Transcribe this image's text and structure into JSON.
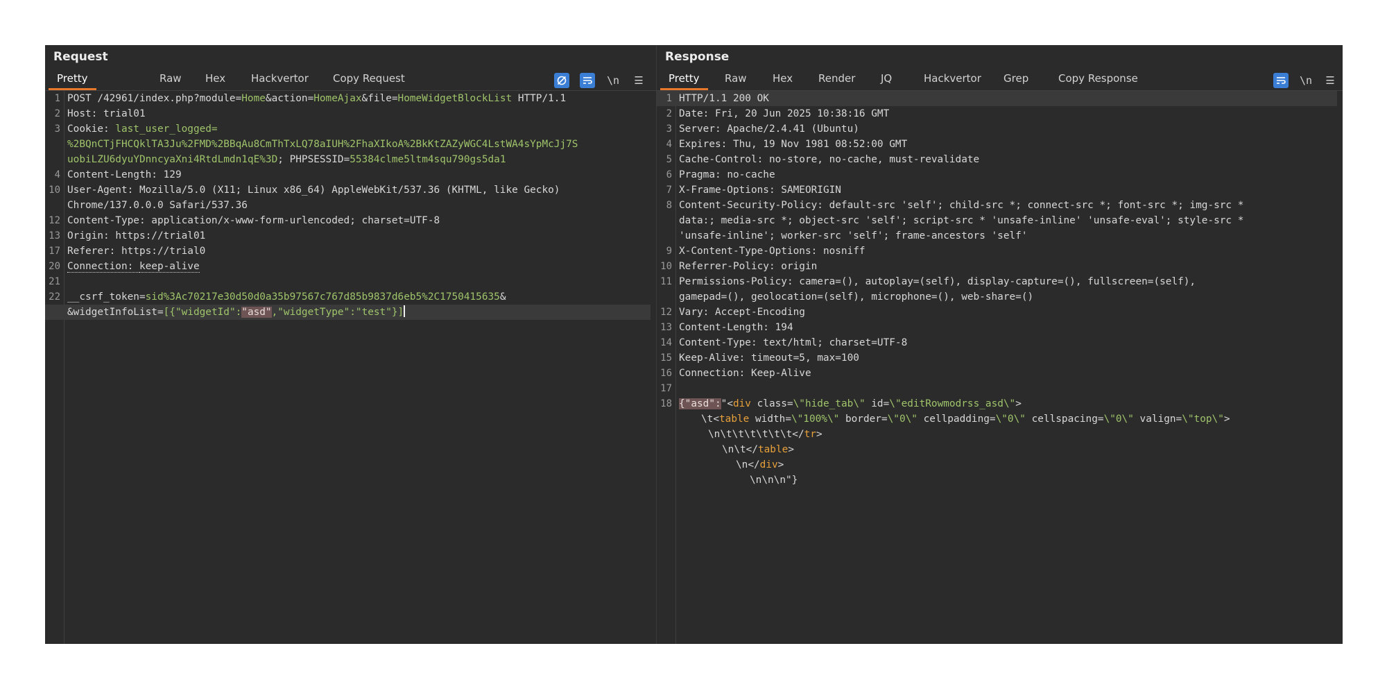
{
  "request": {
    "title": "Request",
    "tabs": [
      "Pretty",
      "Raw",
      "Hex",
      "Hackvertor",
      "Copy Request"
    ],
    "toolbar": {
      "newline_label": "\\n",
      "menu_label": "☰"
    },
    "lines": [
      {
        "n": "1",
        "parts": [
          "POST /42961/index.php?module=",
          "Home",
          "&action=",
          "HomeAjax",
          "&file=",
          "HomeWidgetBlockList",
          " HTTP/1.1"
        ]
      },
      {
        "n": "2",
        "parts": [
          "Host: ",
          "trial01"
        ]
      },
      {
        "n": "3",
        "parts": [
          "Cookie: ",
          "last_user_logged="
        ]
      },
      {
        "n": "",
        "parts": [
          "%2BQnCTjFHCQklTA3Ju%2FMD%2BBqAu8CmThTxLQ78aIUH%2FhaXIkoA%2BkKtZAZyWGC4LstWA4sYpMcJj7S"
        ]
      },
      {
        "n": "",
        "parts": [
          "uobiLZU6dyuYDnncyaXni4RtdLmdn1qE%3D",
          "; ",
          "PHPSESSID",
          "=",
          "55384clme5ltm4squ790gs5da1"
        ]
      },
      {
        "n": "4",
        "parts": [
          "Content-Length: ",
          "129"
        ]
      },
      {
        "n": "10",
        "parts": [
          "User-Agent: ",
          "Mozilla/5.0 (X11; Linux x86_64) AppleWebKit/537.36 (KHTML, like Gecko)"
        ]
      },
      {
        "n": "",
        "parts": [
          "Chrome/137.0.0.0 Safari/537.36"
        ]
      },
      {
        "n": "12",
        "parts": [
          "Content-Type: ",
          "application/x-www-form-urlencoded; charset=UTF-8"
        ]
      },
      {
        "n": "13",
        "parts": [
          "Origin: ",
          "https://trial01"
        ]
      },
      {
        "n": "17",
        "parts": [
          "Referer: ",
          "https://trial0"
        ]
      },
      {
        "n": "20",
        "parts": [
          "Connection: ",
          "keep-alive"
        ]
      },
      {
        "n": "21",
        "parts": [
          ""
        ]
      },
      {
        "n": "22",
        "parts": [
          "__csrf_token",
          "=",
          "sid%3Ac70217e30d50d0a35b97567c767d85b9837d6eb5%2C1750415635",
          "&"
        ]
      },
      {
        "n": "",
        "parts": [
          "&widgetInfoList",
          "=",
          "[{\"widgetId\":",
          "\"asd\"",
          ",\"widgetType\":\"test\"}]"
        ]
      }
    ]
  },
  "response": {
    "title": "Response",
    "tabs": [
      "Pretty",
      "Raw",
      "Hex",
      "Render",
      "JQ",
      "Hackvertor",
      "Grep",
      "Copy Response"
    ],
    "toolbar": {
      "newline_label": "\\n",
      "menu_label": "☰"
    },
    "lines": [
      {
        "n": "1",
        "parts": [
          "HTTP/1.1 200 OK"
        ]
      },
      {
        "n": "2",
        "parts": [
          "Date: ",
          "Fri, 20 Jun 2025 10:38:16 GMT"
        ]
      },
      {
        "n": "3",
        "parts": [
          "Server: ",
          "Apache/2.4.41 (Ubuntu)"
        ]
      },
      {
        "n": "4",
        "parts": [
          "Expires: ",
          "Thu, 19 Nov 1981 08:52:00 GMT"
        ]
      },
      {
        "n": "5",
        "parts": [
          "Cache-Control: ",
          "no-store, no-cache, must-revalidate"
        ]
      },
      {
        "n": "6",
        "parts": [
          "Pragma: ",
          "no-cache"
        ]
      },
      {
        "n": "7",
        "parts": [
          "X-Frame-Options: ",
          "SAMEORIGIN"
        ]
      },
      {
        "n": "8",
        "parts": [
          "Content-Security-Policy: ",
          "default-src 'self'; child-src *; connect-src *; font-src *; img-src *"
        ]
      },
      {
        "n": "",
        "parts": [
          "data:; media-src *; object-src 'self'; script-src * 'unsafe-inline' 'unsafe-eval'; style-src *"
        ]
      },
      {
        "n": "",
        "parts": [
          "'unsafe-inline'; worker-src 'self'; frame-ancestors 'self'"
        ]
      },
      {
        "n": "9",
        "parts": [
          "X-Content-Type-Options: ",
          "nosniff"
        ]
      },
      {
        "n": "10",
        "parts": [
          "Referrer-Policy: ",
          "origin"
        ]
      },
      {
        "n": "11",
        "parts": [
          "Permissions-Policy: ",
          "camera=(), autoplay=(self), display-capture=(), fullscreen=(self),"
        ]
      },
      {
        "n": "",
        "parts": [
          "gamepad=(), geolocation=(self), microphone=(), web-share=()"
        ]
      },
      {
        "n": "12",
        "parts": [
          "Vary: ",
          "Accept-Encoding"
        ]
      },
      {
        "n": "13",
        "parts": [
          "Content-Length: ",
          "194"
        ]
      },
      {
        "n": "14",
        "parts": [
          "Content-Type: ",
          "text/html; charset=UTF-8"
        ]
      },
      {
        "n": "15",
        "parts": [
          "Keep-Alive: ",
          "timeout=5, max=100"
        ]
      },
      {
        "n": "16",
        "parts": [
          "Connection: ",
          "Keep-Alive"
        ]
      },
      {
        "n": "17",
        "parts": [
          ""
        ]
      },
      {
        "n": "18",
        "parts": [
          "{\"asd\":",
          "\"<",
          "div",
          " class",
          "=",
          "\\\"hide_tab\\\"",
          " id",
          "=",
          "\\\"editRowmodrss_asd\\\"",
          ">"
        ]
      },
      {
        "n": "",
        "parts": [
          "\\t<",
          "table",
          " width",
          "=",
          "\\\"100%\\\"",
          " border",
          "=",
          "\\\"0\\\"",
          " cellpadding",
          "=",
          "\\\"0\\\"",
          " cellspacing",
          "=",
          "\\\"0\\\"",
          " valign",
          "=",
          "\\\"top\\\"",
          ">"
        ]
      },
      {
        "n": "",
        "parts": [
          "\\n\\t\\t\\t\\t\\t\\t</",
          "tr",
          ">"
        ]
      },
      {
        "n": "",
        "parts": [
          "\\n\\t</",
          "table",
          ">"
        ]
      },
      {
        "n": "",
        "parts": [
          "\\n</",
          "div",
          ">"
        ]
      },
      {
        "n": "",
        "parts": [
          "\\n\\n\\n\"}"
        ]
      }
    ]
  }
}
